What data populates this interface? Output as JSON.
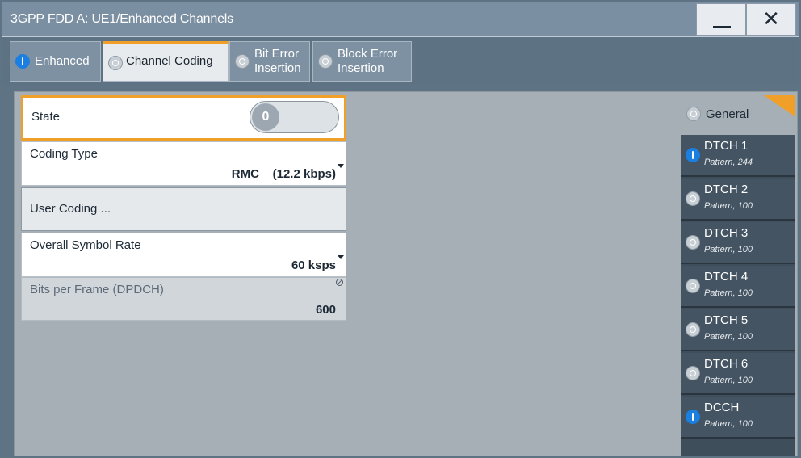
{
  "window": {
    "title": "3GPP FDD A: UE1/Enhanced Channels",
    "minimize_label": "—",
    "close_label": "✕"
  },
  "tabs": [
    {
      "line1": "Enhanced",
      "line2": "",
      "active": false,
      "state": "on"
    },
    {
      "line1": "Channel Coding",
      "line2": "",
      "active": true,
      "state": "off"
    },
    {
      "line1": "Bit Error",
      "line2": "Insertion",
      "active": false,
      "state": "off"
    },
    {
      "line1": "Block Error",
      "line2": "Insertion",
      "active": false,
      "state": "off"
    }
  ],
  "form": {
    "state": {
      "label": "State",
      "toggle_value": "0"
    },
    "coding_type": {
      "label": "Coding Type",
      "value": "RMC    (12.2 kbps)"
    },
    "user_coding": {
      "label": "User Coding ..."
    },
    "symbol_rate": {
      "label": "Overall Symbol Rate",
      "value": "60 ksps"
    },
    "bits_per_frame": {
      "label": "Bits per Frame (DPDCH)",
      "value": "600"
    }
  },
  "channels": {
    "general": {
      "label": "General",
      "state": "off"
    },
    "items": [
      {
        "name": "DTCH 1",
        "sub": "Pattern, 244",
        "state": "on"
      },
      {
        "name": "DTCH 2",
        "sub": "Pattern, 100",
        "state": "off"
      },
      {
        "name": "DTCH 3",
        "sub": "Pattern, 100",
        "state": "off"
      },
      {
        "name": "DTCH 4",
        "sub": "Pattern, 100",
        "state": "off"
      },
      {
        "name": "DTCH 5",
        "sub": "Pattern, 100",
        "state": "off"
      },
      {
        "name": "DTCH 6",
        "sub": "Pattern, 100",
        "state": "off"
      },
      {
        "name": "DCCH",
        "sub": "Pattern, 100",
        "state": "on"
      }
    ]
  },
  "colors": {
    "accent_orange": "#f0a028",
    "indicator_on": "#1a7fe0",
    "title_bar": "#7b8fa2",
    "panel_bg": "#a7afb6"
  }
}
